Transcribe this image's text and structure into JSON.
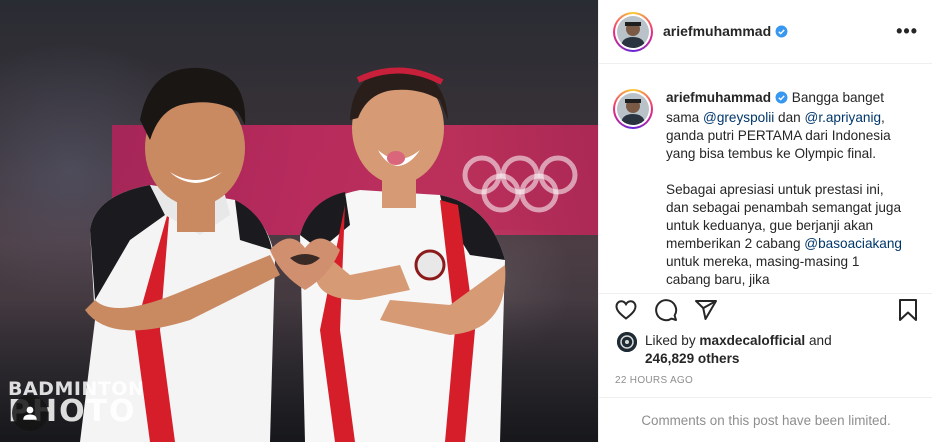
{
  "photo": {
    "watermark_line1": "BADMINTON",
    "watermark_line2": "PHOTO"
  },
  "post": {
    "username": "ariefmuhammad",
    "more_label": "•••",
    "caption": {
      "username": "ariefmuhammad",
      "part1": "Bangga banget sama",
      "mention1": "@greyspolii",
      "part2": "dan",
      "mention2": "@r.apriyanig",
      "part3": ", ganda putri PERTAMA dari Indonesia yang bisa tembus ke Olympic final.",
      "para2_a": "Sebagai apresiasi untuk prestasi ini, dan sebagai penambah semangat juga untuk keduanya, gue berjanji akan memberikan 2 cabang",
      "mention3": "@basoaciakang",
      "para2_b": "untuk mereka, masing-masing 1 cabang baru, jika"
    },
    "likes": {
      "prefix": "Liked by",
      "user": "maxdecalofficial",
      "conj": "and",
      "count": "246,829 others"
    },
    "timestamp": "22 HOURS AGO",
    "comments_notice": "Comments on this post have been limited."
  },
  "colors": {
    "verified_blue": "#3897f0",
    "muted_gray": "#8e8e8e",
    "mention_blue": "#00376b"
  },
  "icons": [
    "verified-badge-icon",
    "more-options-icon",
    "heart-icon",
    "comment-icon",
    "share-icon",
    "bookmark-icon",
    "tag-people-icon"
  ]
}
